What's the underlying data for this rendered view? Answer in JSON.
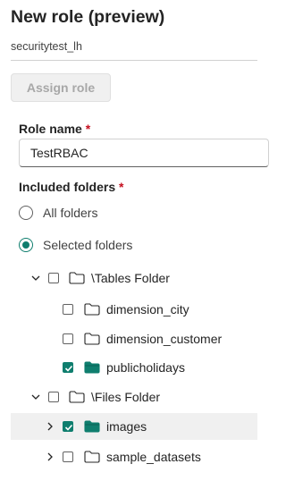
{
  "header": {
    "title": "New role (preview)",
    "subtitle": "securitytest_lh"
  },
  "toolbar": {
    "assign_label": "Assign role"
  },
  "role_name": {
    "label": "Role name",
    "required_mark": "*",
    "value": "TestRBAC"
  },
  "included_folders": {
    "label": "Included folders",
    "required_mark": "*",
    "options": [
      {
        "label": "All folders",
        "checked": false
      },
      {
        "label": "Selected folders",
        "checked": true
      }
    ]
  },
  "tree": [
    {
      "label": "\\Tables Folder",
      "checked": false,
      "expanded": true,
      "folder_style": "outline"
    },
    {
      "label": "dimension_city",
      "checked": false,
      "folder_style": "outline"
    },
    {
      "label": "dimension_customer",
      "checked": false,
      "folder_style": "outline"
    },
    {
      "label": "publicholidays",
      "checked": true,
      "folder_style": "filled"
    },
    {
      "label": "\\Files Folder",
      "checked": false,
      "expanded": true,
      "folder_style": "outline"
    },
    {
      "label": "images",
      "checked": true,
      "expanded": false,
      "folder_style": "filled",
      "highlighted": true
    },
    {
      "label": "sample_datasets",
      "checked": false,
      "expanded": false,
      "folder_style": "outline"
    }
  ],
  "colors": {
    "accent": "#0f7e6e",
    "required": "#c50f1f"
  }
}
